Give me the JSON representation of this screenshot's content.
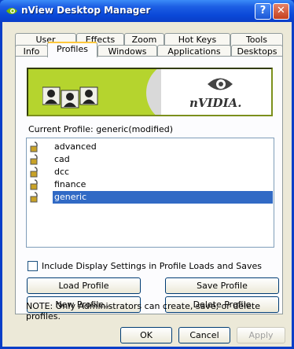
{
  "window": {
    "title": "nView Desktop Manager"
  },
  "tabs_top": [
    "User Interface",
    "Effects",
    "Zoom",
    "Hot Keys",
    "Tools"
  ],
  "tabs_bottom": [
    "Info",
    "Profiles",
    "Windows",
    "Applications",
    "Desktops"
  ],
  "active_tab": "Profiles",
  "banner": {
    "brand": "nVIDIA."
  },
  "current_profile_label": "Current Profile:  generic(modified)",
  "profiles": [
    "advanced",
    "cad",
    "dcc",
    "finance",
    "generic"
  ],
  "selected_profile": "generic",
  "checkbox_label": "Include Display Settings in Profile Loads and Saves",
  "buttons": {
    "load": "Load Profile",
    "save": "Save Profile",
    "new": "New Profile...",
    "delete": "Delete Profile"
  },
  "note": "NOTE: Only Administrators can create, save, or delete profiles.",
  "dialog_buttons": {
    "ok": "OK",
    "cancel": "Cancel",
    "apply": "Apply"
  },
  "colors": {
    "titlebar": "#0a48d8",
    "selection": "#316ac5",
    "banner_green": "#b5d42e"
  }
}
